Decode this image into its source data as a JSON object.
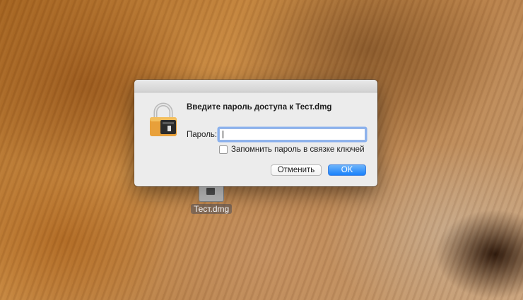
{
  "desktop": {
    "file_icon": "dmg-file-icon",
    "file_label": "Тест.dmg"
  },
  "dialog": {
    "icon": "lock-icon",
    "title": "Введите пароль доступа к Тест.dmg",
    "password_label": "Пароль:",
    "password_value": "",
    "remember_label": "Запомнить пароль в связке ключей",
    "remember_checked": false,
    "cancel_label": "Отменить",
    "ok_label": "OK",
    "accent_color": "#1a82fb"
  }
}
